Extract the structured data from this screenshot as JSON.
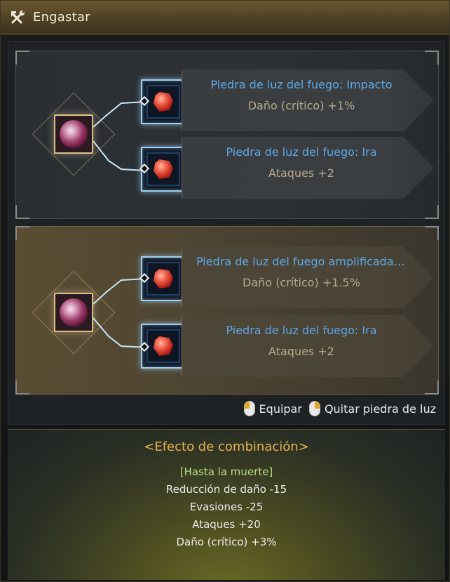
{
  "window": {
    "title": "Engastar",
    "icon": "hammer-wrench-icon"
  },
  "top_panel": {
    "main_stone_icon": "purple-gem-icon",
    "slots": [
      {
        "name": "Piedra de luz del fuego: Impacto",
        "stat": "Daño (crítico) +1%",
        "icon": "red-crystal-icon"
      },
      {
        "name": "Piedra de luz del fuego: Ira",
        "stat": "Ataques +2",
        "icon": "red-crystal-icon"
      }
    ]
  },
  "bottom_panel": {
    "main_stone_icon": "purple-gem-icon",
    "slots": [
      {
        "name": "Piedra de luz del fuego amplificada: I...",
        "stat": "Daño (crítico) +1.5%",
        "icon": "red-crystal-icon"
      },
      {
        "name": "Piedra de luz del fuego: Ira",
        "stat": "Ataques +2",
        "icon": "red-crystal-icon"
      }
    ]
  },
  "actions": {
    "equip_label": "Equipar",
    "remove_label": "Quitar piedra de luz"
  },
  "combination": {
    "title": "<Efecto de combinación>",
    "condition": "[Hasta la muerte]",
    "effects": [
      "Reducción de daño -15",
      "Evasiones -25",
      "Ataques +20",
      "Daño (crítico) +3%"
    ]
  },
  "colors": {
    "accent_gold": "#e8b248",
    "slot_name_blue": "#5ea8e6",
    "condition_green": "#b8dc82"
  }
}
